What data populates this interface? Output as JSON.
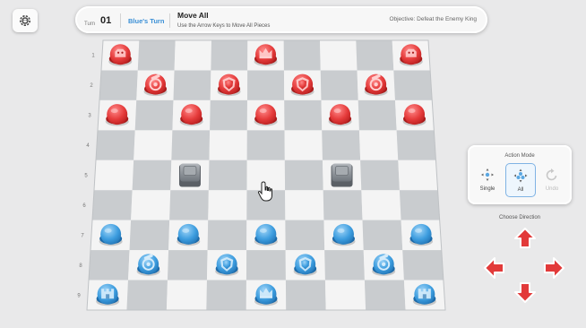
{
  "topbar": {
    "turn_label": "Turn",
    "turn_number": "01",
    "player_turn": "Blue's Turn",
    "move_title": "Move All",
    "move_subtitle": "Use the Arrow Keys to Move All Pieces",
    "objective": "Objective: Defeat the Enemy King"
  },
  "colors": {
    "red_team": "#e53b3b",
    "blue_team": "#3d9ddf",
    "obstacle": "#8f949a",
    "light_square": "#f4f4f4",
    "dark_square": "#c9cccf",
    "accent": "#3a8fd6"
  },
  "board": {
    "files": 9,
    "ranks": 9,
    "rank_labels": [
      "1",
      "2",
      "3",
      "4",
      "5",
      "6",
      "7",
      "8",
      "9"
    ],
    "pieces": [
      {
        "team": "red",
        "type": "soldier",
        "file": 1,
        "rank": 1
      },
      {
        "team": "red",
        "type": "king",
        "file": 5,
        "rank": 1
      },
      {
        "team": "red",
        "type": "soldier",
        "file": 9,
        "rank": 1
      },
      {
        "team": "red",
        "type": "cannon",
        "file": 2,
        "rank": 2
      },
      {
        "team": "red",
        "type": "shield",
        "file": 4,
        "rank": 2
      },
      {
        "team": "red",
        "type": "shield",
        "file": 6,
        "rank": 2
      },
      {
        "team": "red",
        "type": "cannon",
        "file": 8,
        "rank": 2
      },
      {
        "team": "red",
        "type": "pawn",
        "file": 1,
        "rank": 3
      },
      {
        "team": "red",
        "type": "pawn",
        "file": 3,
        "rank": 3
      },
      {
        "team": "red",
        "type": "pawn",
        "file": 5,
        "rank": 3
      },
      {
        "team": "red",
        "type": "pawn",
        "file": 7,
        "rank": 3
      },
      {
        "team": "red",
        "type": "pawn",
        "file": 9,
        "rank": 3
      },
      {
        "team": "obstacle",
        "type": "block",
        "file": 3,
        "rank": 5
      },
      {
        "team": "obstacle",
        "type": "block",
        "file": 7,
        "rank": 5
      },
      {
        "team": "blue",
        "type": "pawn",
        "file": 1,
        "rank": 7
      },
      {
        "team": "blue",
        "type": "pawn",
        "file": 3,
        "rank": 7
      },
      {
        "team": "blue",
        "type": "pawn",
        "file": 5,
        "rank": 7
      },
      {
        "team": "blue",
        "type": "pawn",
        "file": 7,
        "rank": 7
      },
      {
        "team": "blue",
        "type": "pawn",
        "file": 9,
        "rank": 7
      },
      {
        "team": "blue",
        "type": "cannon",
        "file": 2,
        "rank": 8
      },
      {
        "team": "blue",
        "type": "shield",
        "file": 4,
        "rank": 8
      },
      {
        "team": "blue",
        "type": "shield",
        "file": 6,
        "rank": 8
      },
      {
        "team": "blue",
        "type": "cannon",
        "file": 8,
        "rank": 8
      },
      {
        "team": "blue",
        "type": "tower",
        "file": 1,
        "rank": 9
      },
      {
        "team": "blue",
        "type": "king",
        "file": 5,
        "rank": 9
      },
      {
        "team": "blue",
        "type": "tower",
        "file": 9,
        "rank": 9
      }
    ]
  },
  "action_mode": {
    "title": "Action Mode",
    "single_label": "Single",
    "all_label": "All",
    "undo_label": "Undo",
    "selected": "All"
  },
  "direction": {
    "title": "Choose Direction",
    "up_icon": "arrow-up-icon",
    "down_icon": "arrow-down-icon",
    "left_icon": "arrow-left-icon",
    "right_icon": "arrow-right-icon"
  }
}
